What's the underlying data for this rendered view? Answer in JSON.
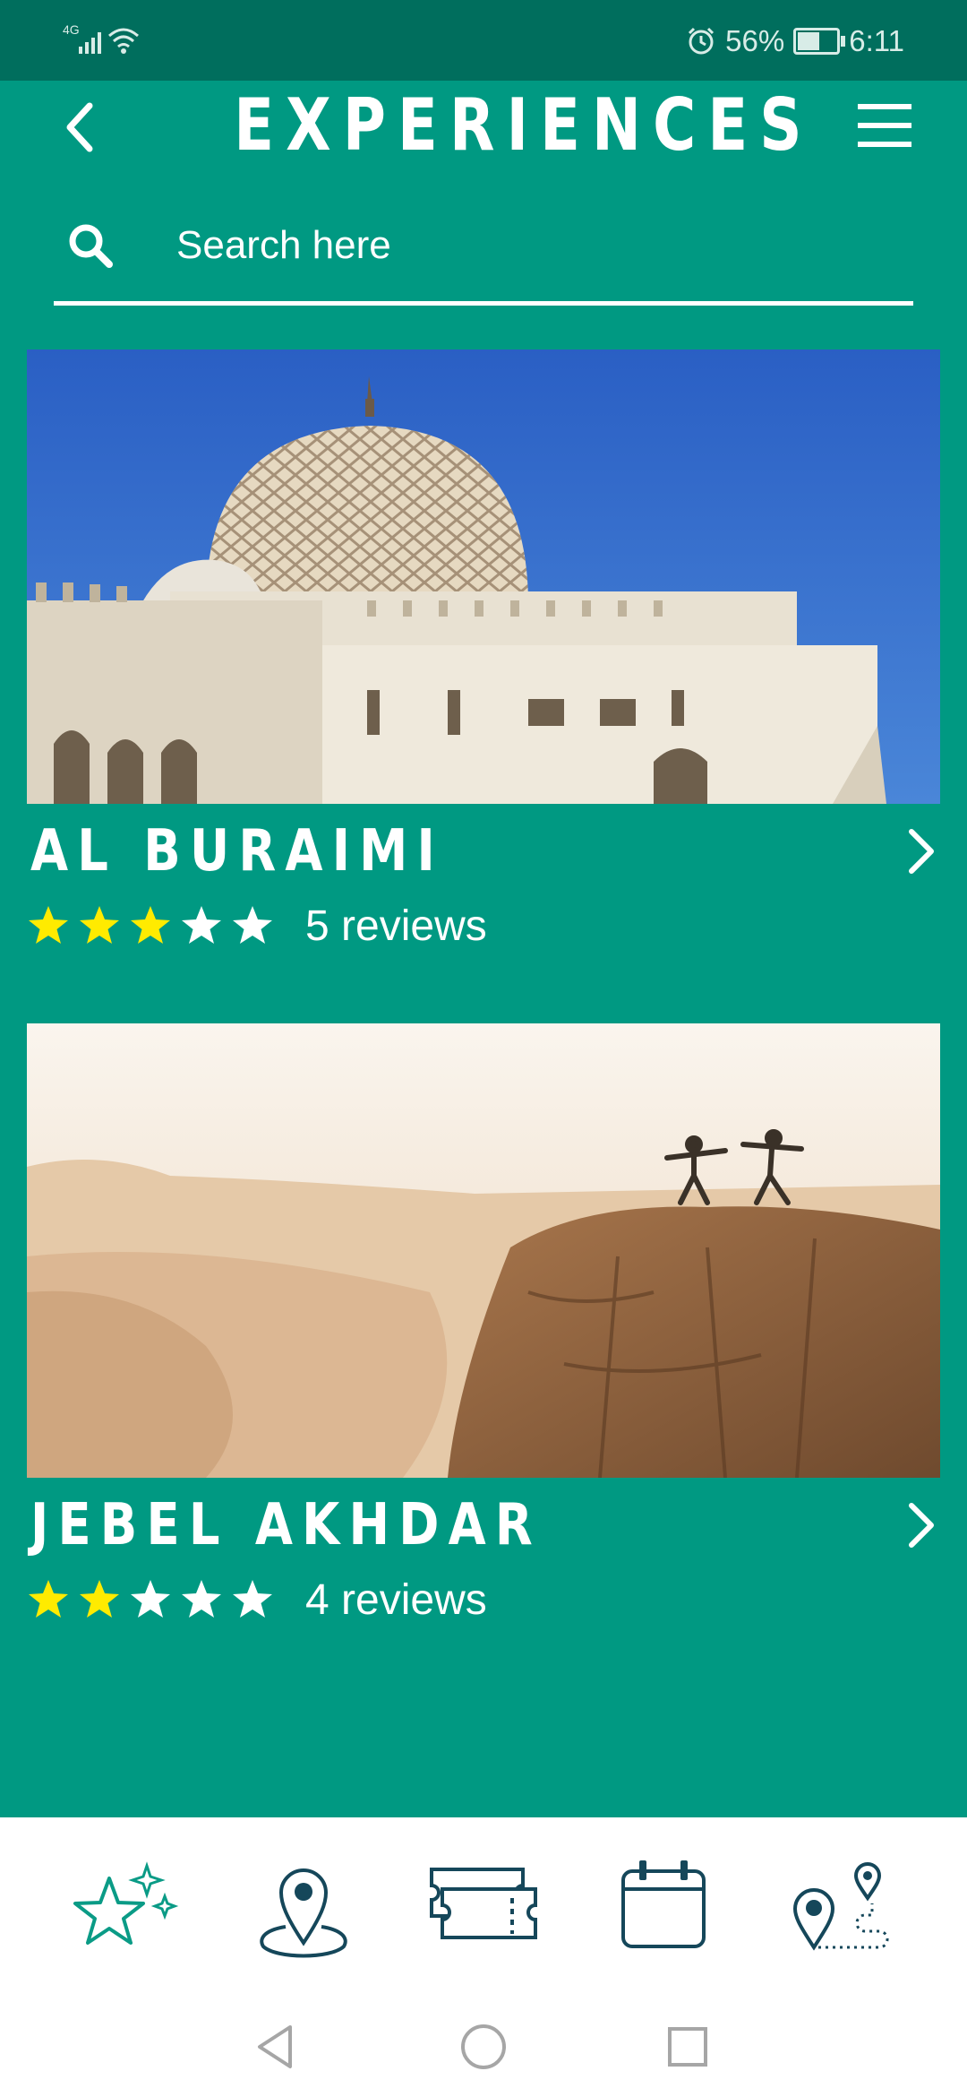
{
  "status_bar": {
    "network": "4G",
    "battery_percent": 56,
    "battery_text": "56%",
    "time": "6:11"
  },
  "header": {
    "title": "EXPERIENCES"
  },
  "search": {
    "placeholder": "Search here",
    "value": ""
  },
  "experiences": [
    {
      "name": "AL BURAIMI",
      "rating": 3,
      "max_rating": 5,
      "reviews": "5 reviews"
    },
    {
      "name": "JEBEL AKHDAR",
      "rating": 2,
      "max_rating": 5,
      "reviews": "4 reviews"
    }
  ],
  "bottom_nav": {
    "items": [
      "sparkle-star-icon",
      "map-pin-icon",
      "ticket-icon",
      "calendar-icon",
      "route-icon"
    ]
  },
  "colors": {
    "background": "#009982",
    "status_bar": "#006e5d",
    "star_filled": "#ffeb00",
    "star_empty": "#ffffff",
    "icon_dark": "#15475a",
    "icon_teal": "#0a9b86"
  }
}
